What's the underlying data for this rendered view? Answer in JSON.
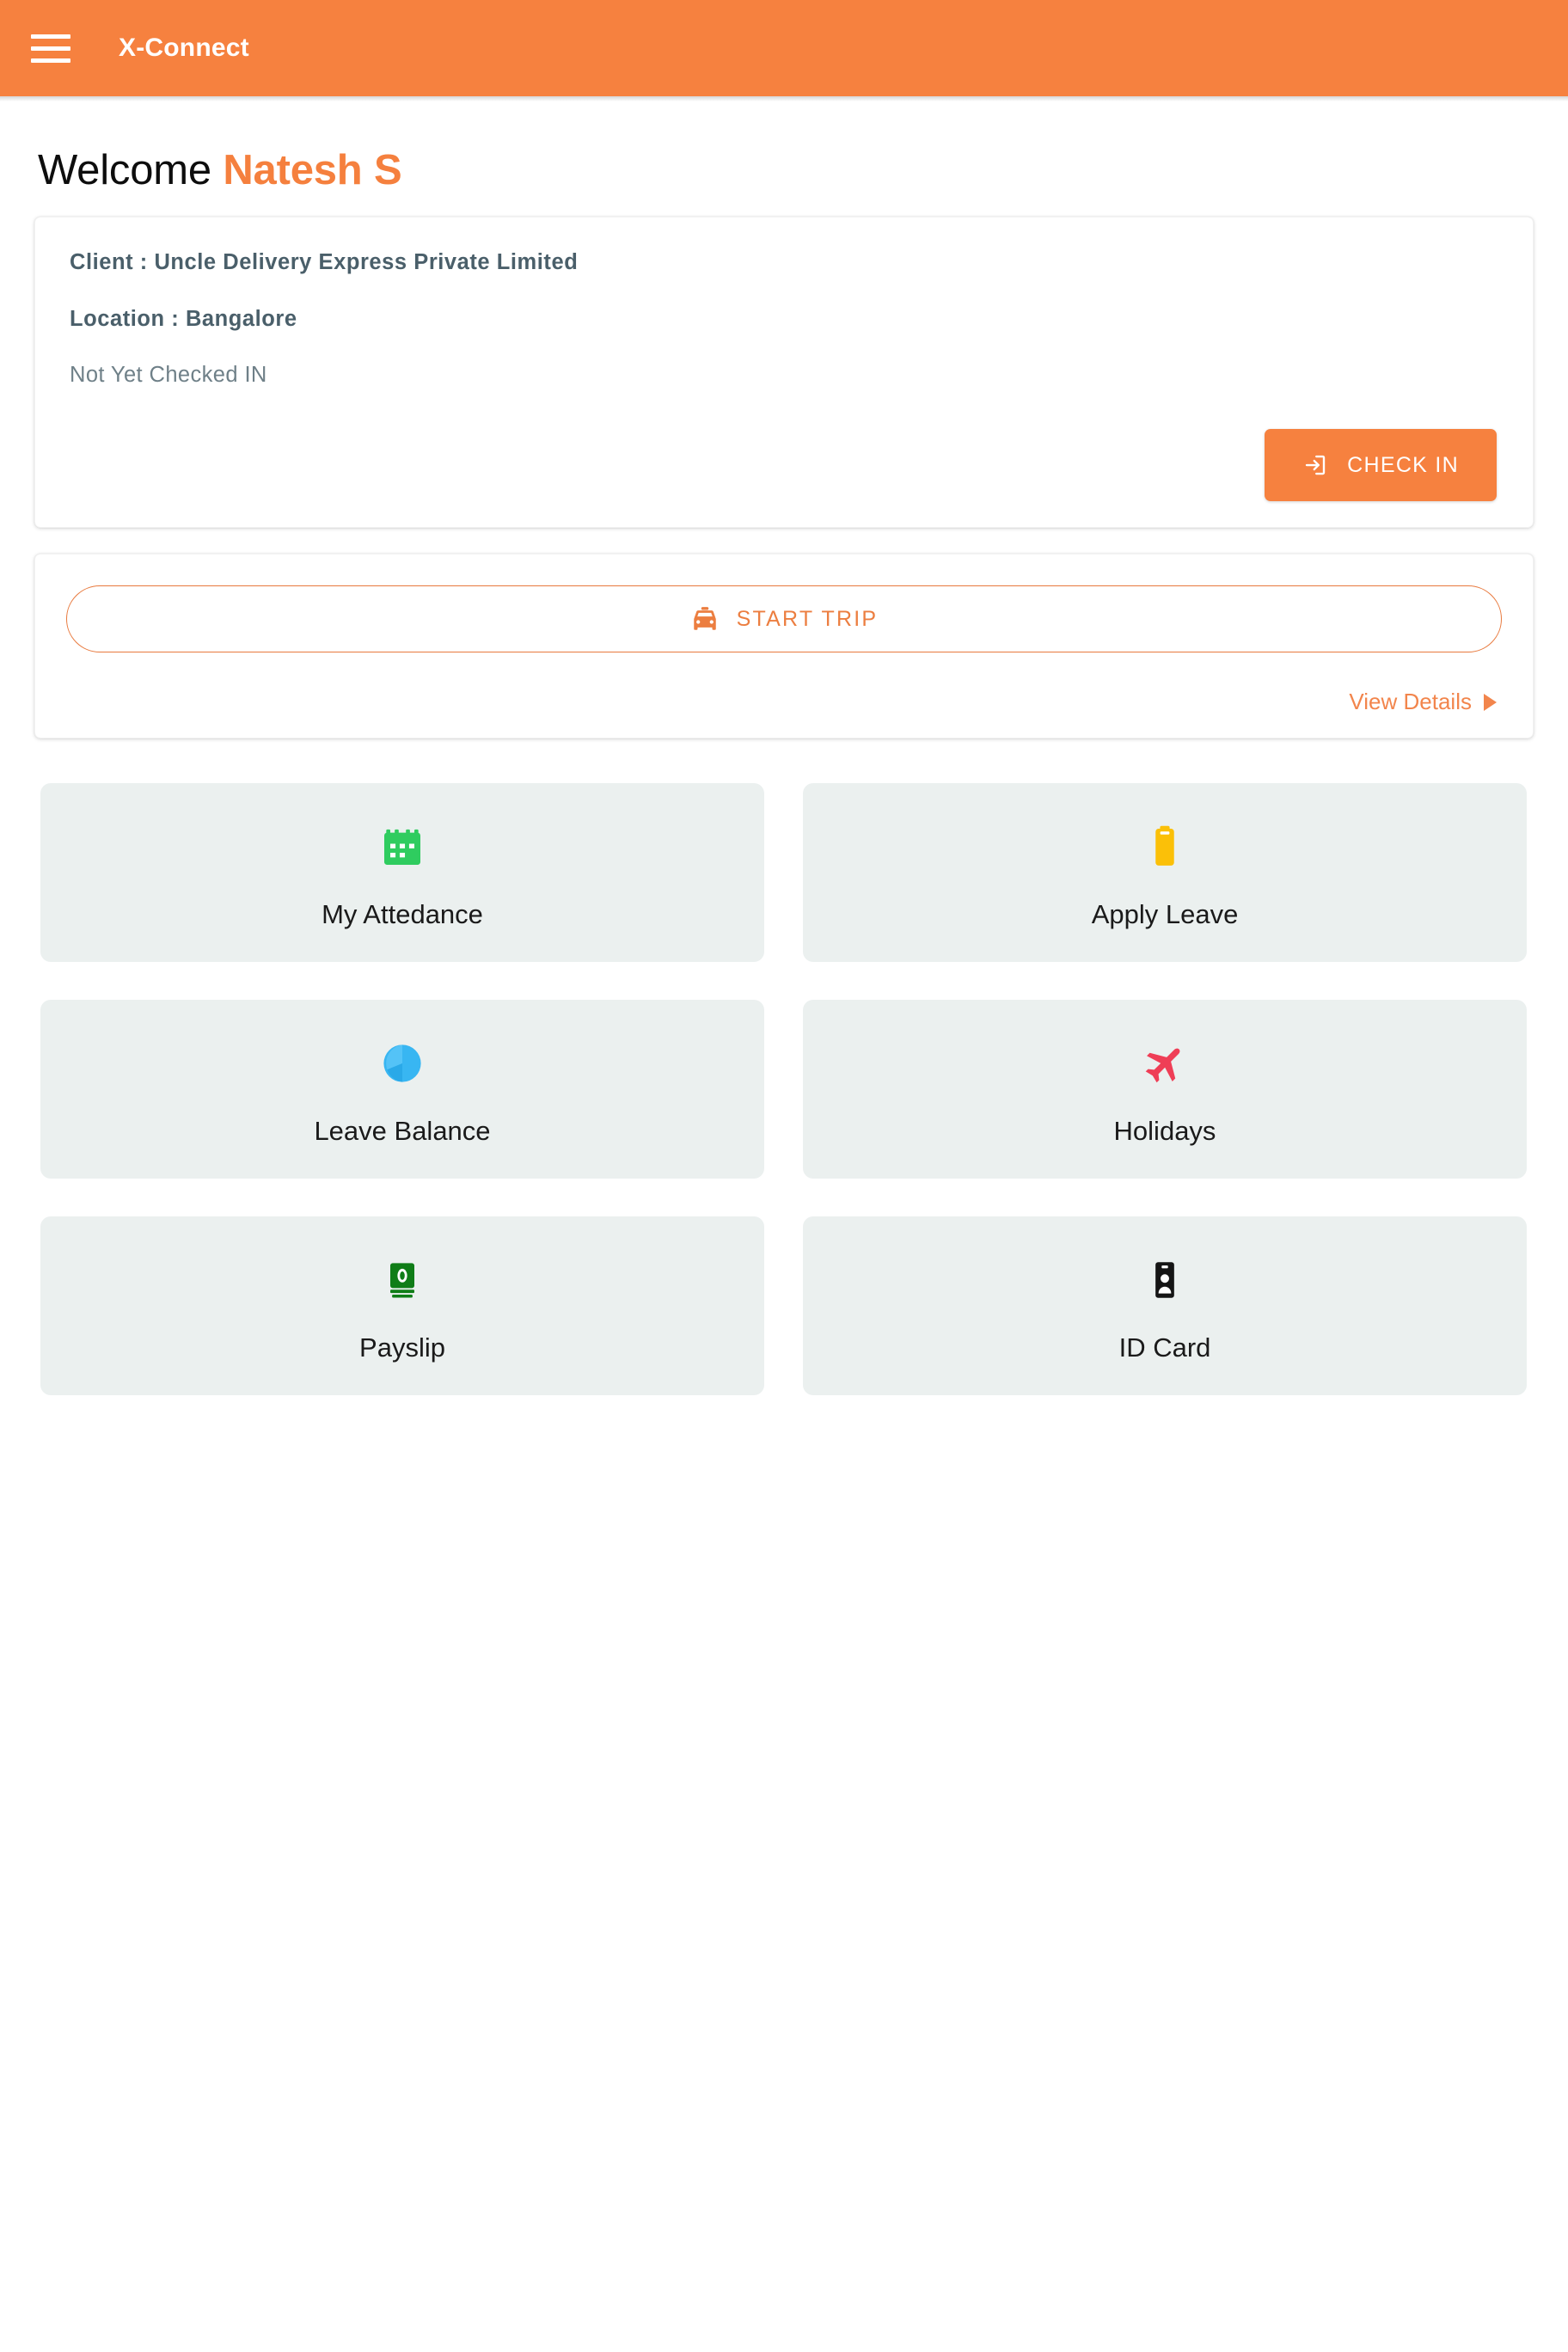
{
  "appbar": {
    "menu_icon": "hamburger-menu-icon",
    "title": "X-Connect",
    "background_color": "#f6813f"
  },
  "welcome": {
    "greeting": "Welcome",
    "user_name": "Natesh S",
    "accent_color": "#f5803e"
  },
  "info_card": {
    "client": "Client : Uncle Delivery Express Private Limited",
    "location": "Location : Bangalore",
    "status": "Not Yet Checked IN",
    "check_in_button": {
      "label": "CHECK IN",
      "icon": "login-arrow-icon",
      "background_color": "#f6813f"
    }
  },
  "trip_card": {
    "start_trip_button": {
      "label": "START TRIP",
      "icon": "car-icon",
      "border_color": "#e8793d",
      "text_color": "#ec7e40"
    },
    "view_details": {
      "label": "View Details",
      "icon": "caret-right-icon",
      "color": "#f2854c"
    }
  },
  "tiles": [
    {
      "label": "My Attedance",
      "icon": "calendar-icon",
      "icon_color": "#2fcc5f"
    },
    {
      "label": "Apply Leave",
      "icon": "clipboard-icon",
      "icon_color": "#fbc008"
    },
    {
      "label": "Leave Balance",
      "icon": "pie-chart-icon",
      "icon_color": "#38b6f2"
    },
    {
      "label": "Holidays",
      "icon": "airplane-icon",
      "icon_color": "#ef3e56"
    },
    {
      "label": "Payslip",
      "icon": "banknote-icon",
      "icon_color": "#0f7d17"
    },
    {
      "label": "ID Card",
      "icon": "id-badge-icon",
      "icon_color": "#151515"
    }
  ],
  "tile_background_color": "#ebf0ef"
}
